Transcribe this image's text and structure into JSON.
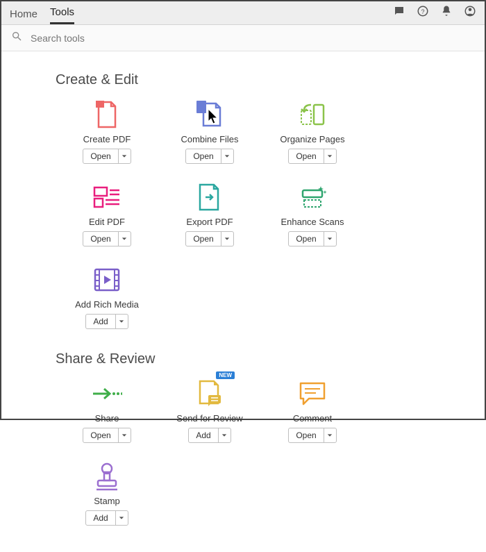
{
  "topbar": {
    "tabs": {
      "home": "Home",
      "tools": "Tools"
    }
  },
  "search": {
    "placeholder": "Search tools"
  },
  "sections": {
    "createEdit": {
      "title": "Create & Edit",
      "tools": {
        "createPdf": {
          "label": "Create PDF",
          "action": "Open"
        },
        "combineFiles": {
          "label": "Combine Files",
          "action": "Open"
        },
        "organizePages": {
          "label": "Organize Pages",
          "action": "Open"
        },
        "editPdf": {
          "label": "Edit PDF",
          "action": "Open"
        },
        "exportPdf": {
          "label": "Export PDF",
          "action": "Open"
        },
        "enhanceScans": {
          "label": "Enhance Scans",
          "action": "Open"
        },
        "addRichMedia": {
          "label": "Add Rich Media",
          "action": "Add"
        }
      }
    },
    "shareReview": {
      "title": "Share & Review",
      "tools": {
        "share": {
          "label": "Share",
          "action": "Open"
        },
        "sendForReview": {
          "label": "Send for Review",
          "action": "Add",
          "badge": "NEW"
        },
        "comment": {
          "label": "Comment",
          "action": "Open"
        },
        "stamp": {
          "label": "Stamp",
          "action": "Add"
        }
      }
    }
  }
}
